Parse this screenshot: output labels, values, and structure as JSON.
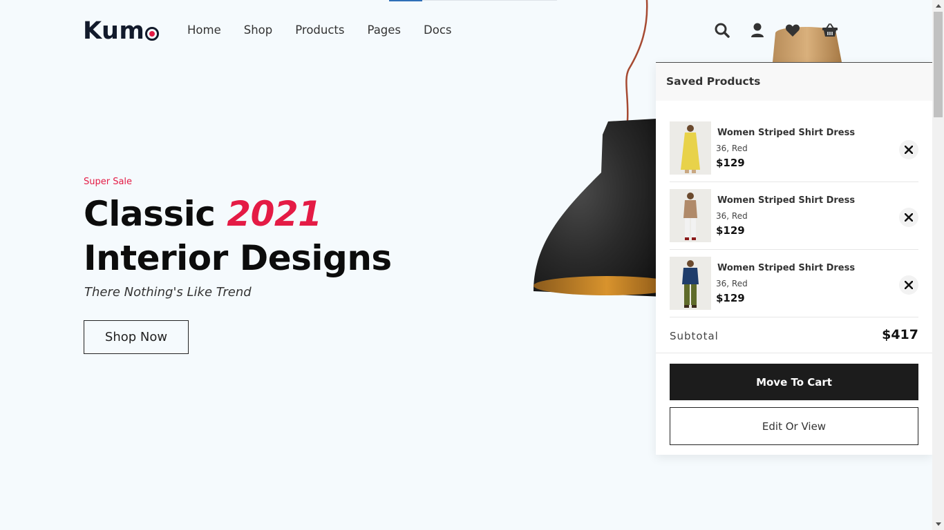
{
  "header": {
    "logo": "Kumo",
    "nav": [
      "Home",
      "Shop",
      "Products",
      "Pages",
      "Docs"
    ],
    "icons": [
      "search-icon",
      "user-icon",
      "heart-icon",
      "basket-icon"
    ]
  },
  "hero": {
    "eyebrow": "Super Sale",
    "headline_1": "Classic ",
    "headline_accent": "2021",
    "headline_2": "Interior Designs",
    "tagline": "There Nothing's Like Trend",
    "cta": "Shop Now"
  },
  "saved_panel": {
    "title": "Saved Products",
    "items": [
      {
        "name": "Women Striped Shirt Dress",
        "variant": "36, Red",
        "price": "$129"
      },
      {
        "name": "Women Striped Shirt Dress",
        "variant": "36, Red",
        "price": "$129"
      },
      {
        "name": "Women Striped Shirt Dress",
        "variant": "36, Red",
        "price": "$129"
      }
    ],
    "subtotal_label": "Subtotal",
    "subtotal_value": "$417",
    "move_to_cart": "Move To Cart",
    "edit_or_view": "Edit Or View"
  },
  "colors": {
    "accent": "#e41b45",
    "background": "#f5fafd",
    "dark": "#1c1c1c"
  }
}
